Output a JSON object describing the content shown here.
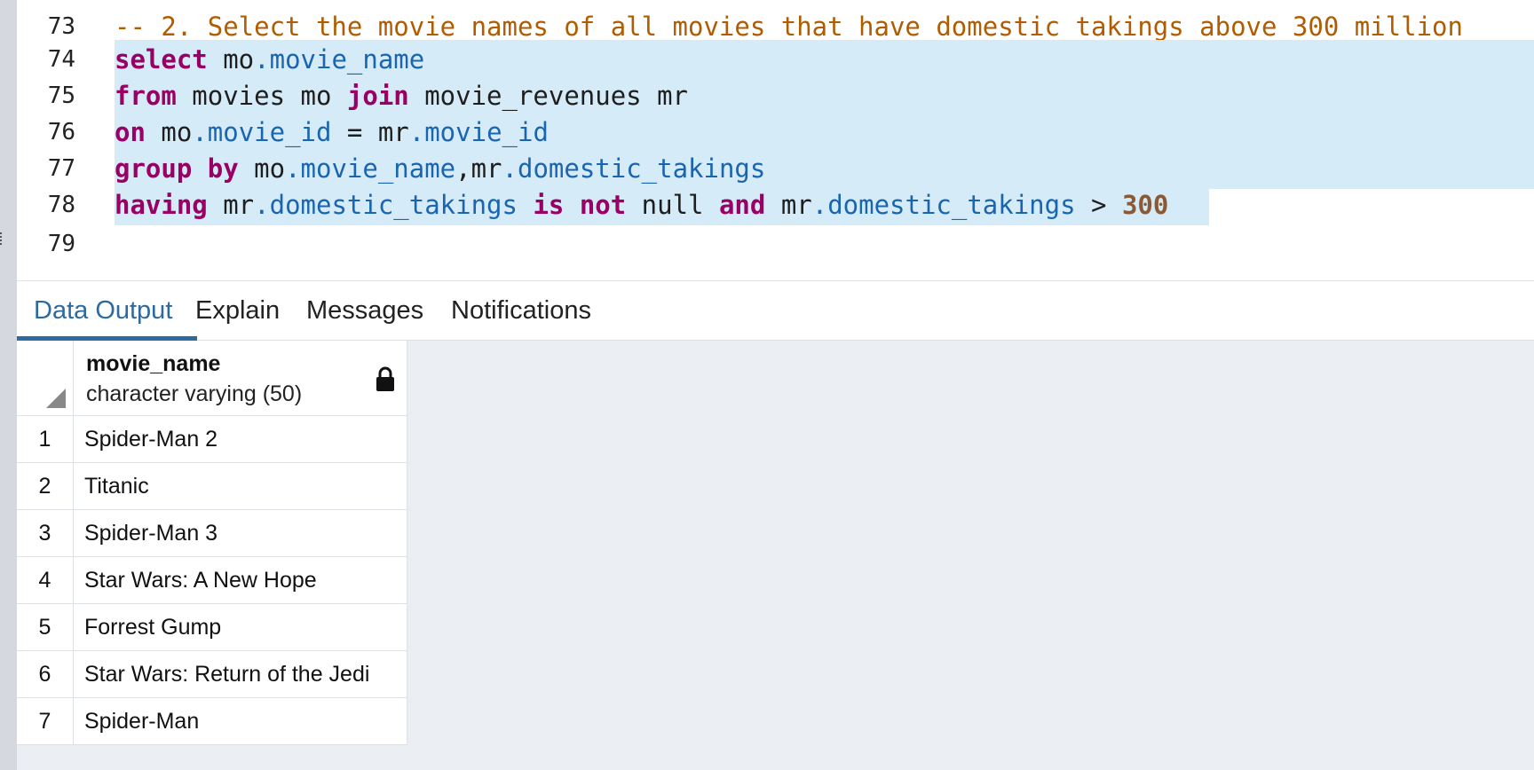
{
  "editor": {
    "lines": [
      {
        "num": "73",
        "parts": [
          {
            "t": "-- 2. Select the movie names of all movies that have domestic takings above 300 million",
            "c": "cmt"
          }
        ]
      },
      {
        "num": "74",
        "parts": [
          {
            "t": "select",
            "c": "kw"
          },
          {
            "t": " mo",
            "c": ""
          },
          {
            "t": ".movie_name",
            "c": "fld"
          }
        ]
      },
      {
        "num": "75",
        "parts": [
          {
            "t": "from",
            "c": "kw"
          },
          {
            "t": " movies mo ",
            "c": ""
          },
          {
            "t": "join",
            "c": "kw"
          },
          {
            "t": " movie_revenues mr",
            "c": ""
          }
        ]
      },
      {
        "num": "76",
        "parts": [
          {
            "t": "on",
            "c": "kw"
          },
          {
            "t": " mo",
            "c": ""
          },
          {
            "t": ".movie_id",
            "c": "fld"
          },
          {
            "t": " = mr",
            "c": ""
          },
          {
            "t": ".movie_id",
            "c": "fld"
          }
        ]
      },
      {
        "num": "77",
        "parts": [
          {
            "t": "group by",
            "c": "kw"
          },
          {
            "t": " mo",
            "c": ""
          },
          {
            "t": ".movie_name",
            "c": "fld"
          },
          {
            "t": ",mr",
            "c": ""
          },
          {
            "t": ".domestic_takings",
            "c": "fld"
          }
        ]
      },
      {
        "num": "78",
        "parts": [
          {
            "t": "having",
            "c": "kw"
          },
          {
            "t": " mr",
            "c": ""
          },
          {
            "t": ".domestic_takings",
            "c": "fld"
          },
          {
            "t": " ",
            "c": ""
          },
          {
            "t": "is not",
            "c": "kw"
          },
          {
            "t": " null ",
            "c": ""
          },
          {
            "t": "and",
            "c": "kw"
          },
          {
            "t": " mr",
            "c": ""
          },
          {
            "t": ".domestic_takings",
            "c": "fld"
          },
          {
            "t": " > ",
            "c": ""
          },
          {
            "t": "300",
            "c": "num"
          }
        ]
      },
      {
        "num": "79",
        "parts": []
      }
    ]
  },
  "tabs": [
    {
      "label": "Data Output",
      "active": true
    },
    {
      "label": "Explain",
      "active": false
    },
    {
      "label": "Messages",
      "active": false
    },
    {
      "label": "Notifications",
      "active": false
    }
  ],
  "grid": {
    "column": {
      "name": "movie_name",
      "type": "character varying (50)",
      "icon": "lock-icon"
    },
    "rows": [
      {
        "num": "1",
        "value": "Spider-Man 2"
      },
      {
        "num": "2",
        "value": "Titanic"
      },
      {
        "num": "3",
        "value": "Spider-Man 3"
      },
      {
        "num": "4",
        "value": "Star Wars: A New Hope"
      },
      {
        "num": "5",
        "value": "Forrest Gump"
      },
      {
        "num": "6",
        "value": "Star Wars: Return of the Jedi"
      },
      {
        "num": "7",
        "value": "Spider-Man"
      }
    ]
  },
  "colors": {
    "selection": "#d5ebf8",
    "keyword": "#990066",
    "field": "#1a65b0",
    "comment": "#b15c00",
    "number": "#8a5a36",
    "active_tab": "#2d6a9f"
  }
}
